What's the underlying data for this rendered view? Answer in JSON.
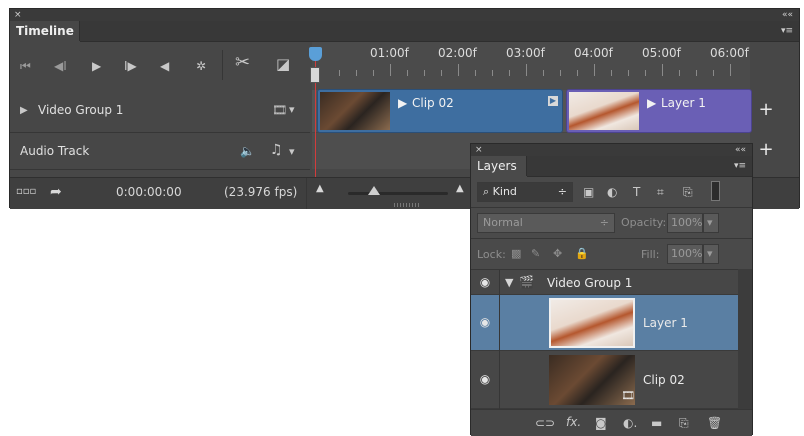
{
  "timeline": {
    "title": "Timeline",
    "close_glyph": "×",
    "collapse_glyph": "««",
    "menu_glyph": "▾≡",
    "controls": {
      "go_first_icon": "⏮",
      "prev_frame_icon": "◀I",
      "play_icon": "▶",
      "next_frame_icon": "I▶",
      "audio_icon": "◀",
      "settings_icon": "✲",
      "cut_icon": "✂",
      "transition_icon": "◪"
    },
    "ruler": [
      "01:00f",
      "02:00f",
      "03:00f",
      "04:00f",
      "05:00f",
      "06:00f"
    ],
    "tracks": {
      "video_group": {
        "label": "Video Group 1",
        "expand_icon": "▶",
        "film_icon": "🎞"
      },
      "audio": {
        "label": "Audio Track",
        "speaker_icon": "🔈",
        "note_icon": "♫"
      }
    },
    "clips": [
      {
        "title": "Clip 02",
        "color": "#3e6ea0"
      },
      {
        "title": "Layer 1",
        "color": "#6a5fb5"
      }
    ],
    "add_glyph": "+",
    "bottom": {
      "timecode": "0:00:00:00",
      "fps": "(23.976 fps)"
    }
  },
  "layers": {
    "title": "Layers",
    "close_glyph": "×",
    "collapse_glyph": "««",
    "menu_glyph": "▾≡",
    "filter": {
      "label": "Kind",
      "search_icon": "⌕",
      "chevron": "÷"
    },
    "filter_icons": [
      "▣",
      "◐",
      "T",
      "⌗",
      "⎘"
    ],
    "blend_mode": "Normal",
    "opacity_label": "Opacity:",
    "opacity_value": "100%",
    "lock_label": "Lock:",
    "fill_label": "Fill:",
    "fill_value": "100%",
    "items": [
      {
        "name": "Video Group 1",
        "eye": "◉",
        "kind": "group"
      },
      {
        "name": "Layer 1",
        "eye": "◉",
        "kind": "layer",
        "selected": true
      },
      {
        "name": "Clip 02",
        "eye": "◉",
        "kind": "video"
      }
    ],
    "bottom_icons": [
      "⊂⊃",
      "fx.",
      "◙",
      "◐.",
      "▬",
      "⎘",
      "🗑"
    ]
  }
}
